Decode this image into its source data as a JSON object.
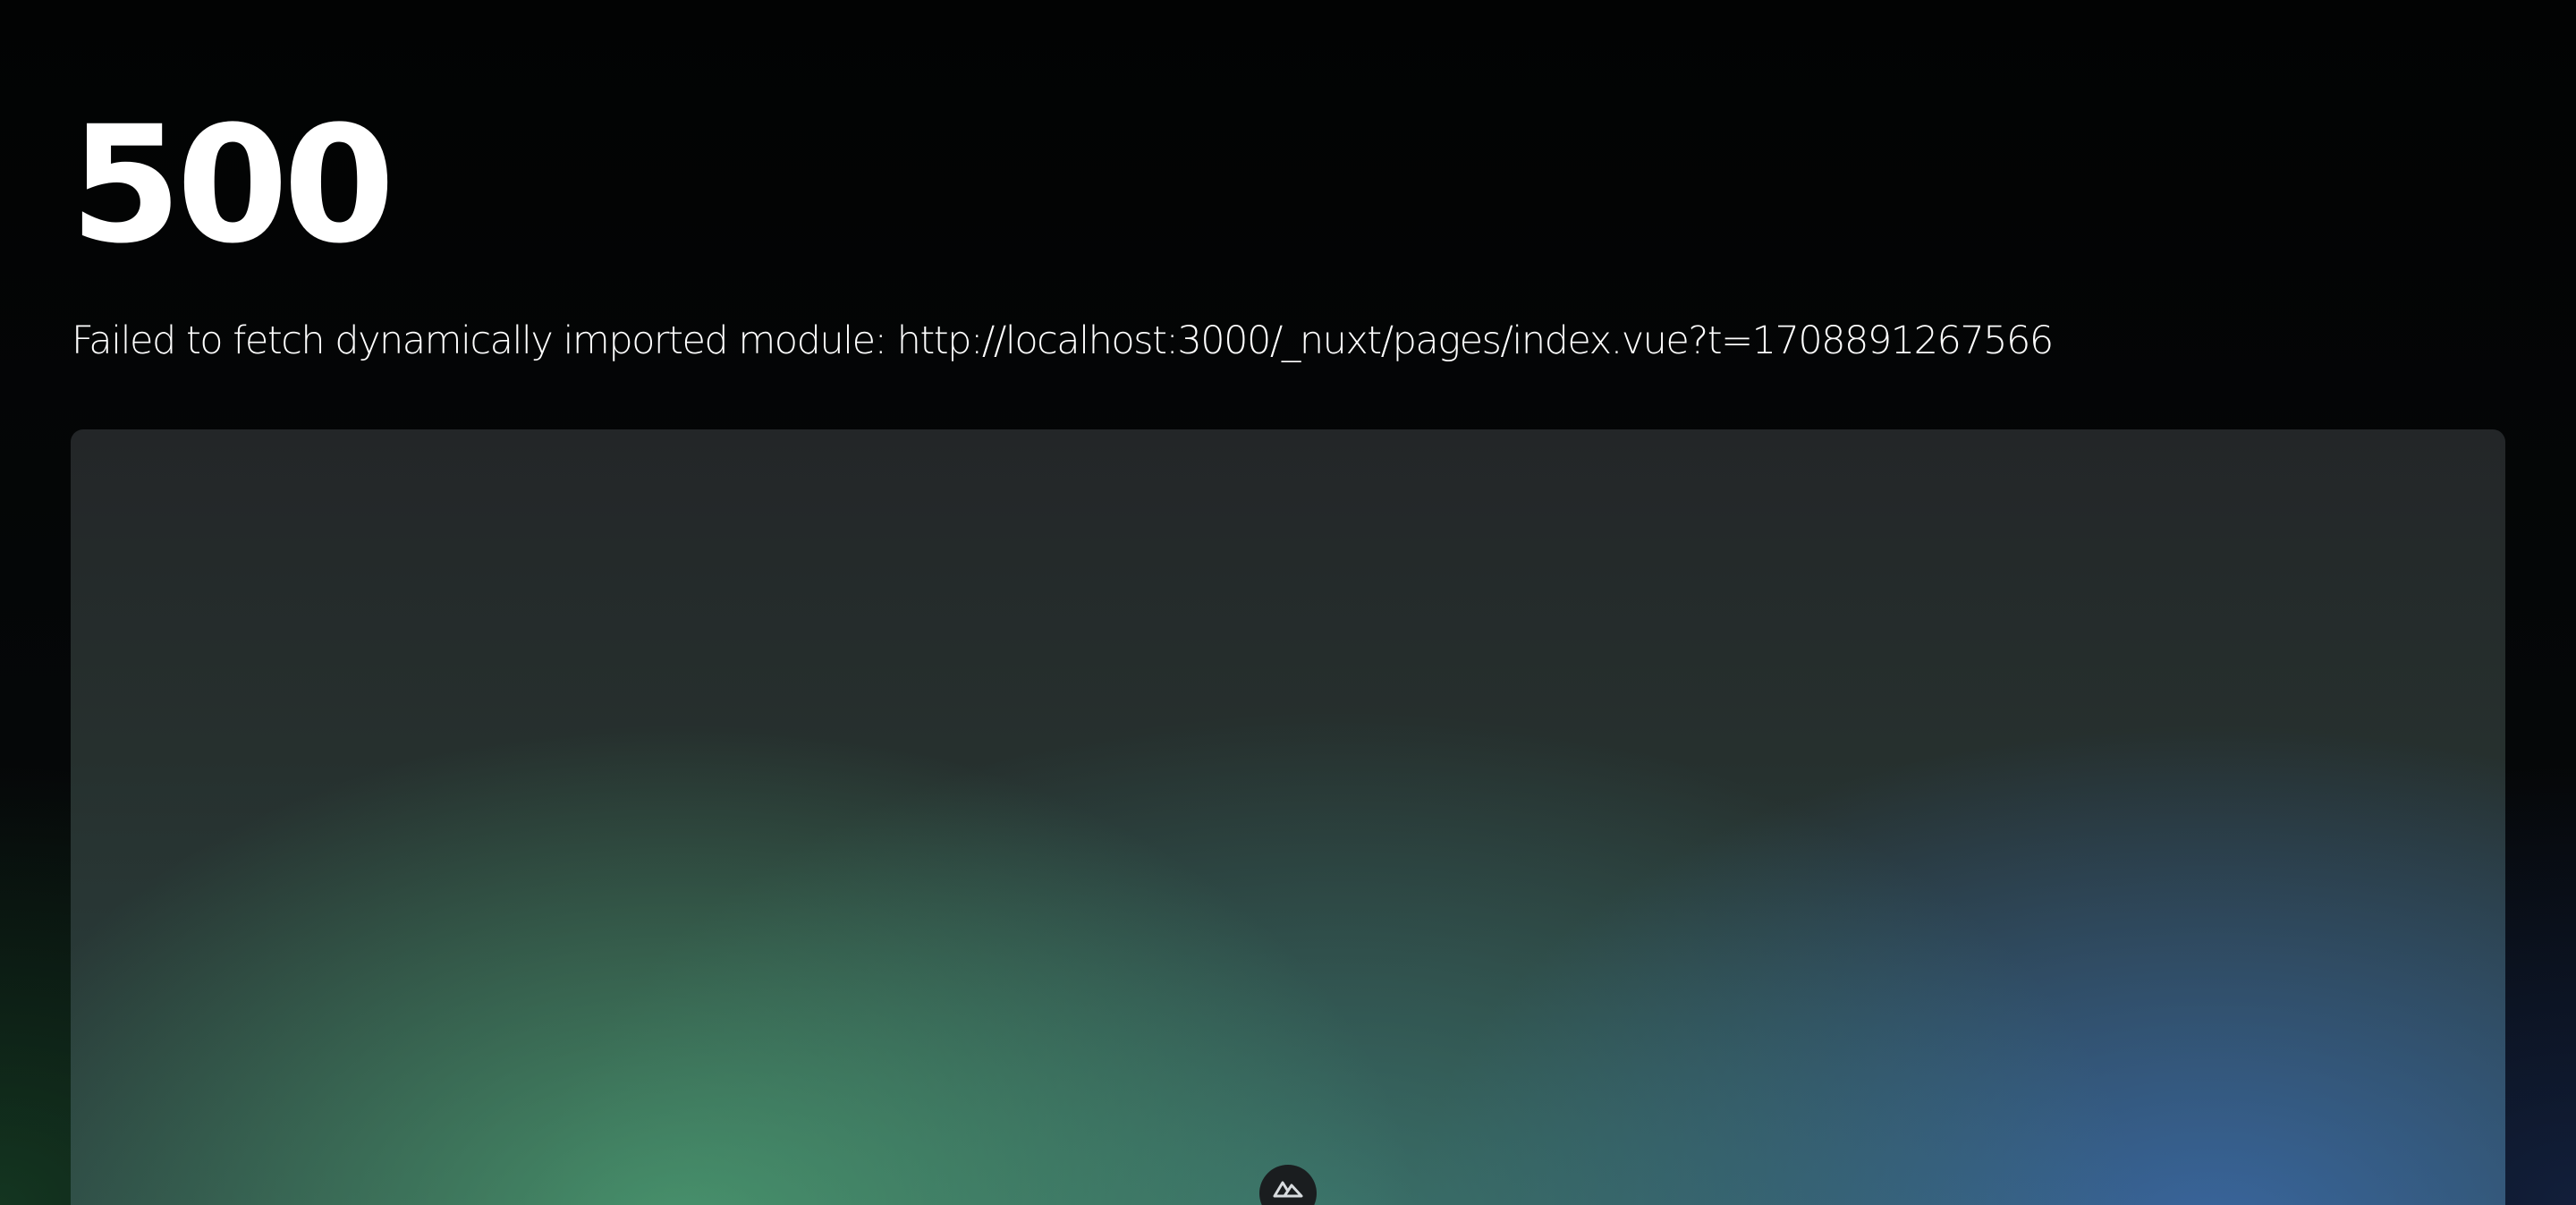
{
  "error": {
    "status_code": "500",
    "message": "Failed to fetch dynamically imported module: http://localhost:3000/_nuxt/pages/index.vue?t=1708891267566"
  },
  "colors": {
    "background": "#030405",
    "text": "#ffffff",
    "panel_green": "#3f8a6c",
    "panel_blue": "#2e4f7a"
  },
  "icons": {
    "devtools_badge": "nuxt-logo-icon"
  }
}
